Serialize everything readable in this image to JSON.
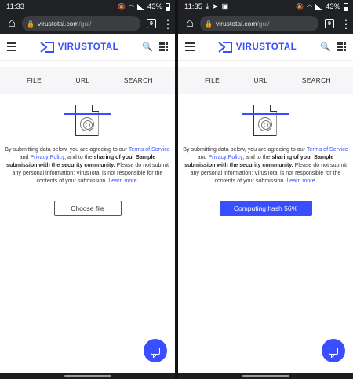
{
  "panels": [
    {
      "status": {
        "time": "11:33",
        "battery": "43%"
      },
      "url": {
        "domain": "virustotal.com",
        "path": "/gui/"
      },
      "tabs_count": "9",
      "logo": "VIRUSTOTAL",
      "nav_tabs": [
        "FILE",
        "URL",
        "SEARCH"
      ],
      "notice": {
        "part1": "By submitting data below, you are agreeing to our ",
        "tos": "Terms of Service",
        "part2": " and ",
        "privacy": "Privacy Policy",
        "part3": ", and to the ",
        "bold": "sharing of your Sample submission with the security community.",
        "part4": " Please do not submit any personal information; VirusTotal is not responsible for the contents of your submission. ",
        "learn": "Learn more."
      },
      "button_label": "Choose file"
    },
    {
      "status": {
        "time": "11:35",
        "battery": "43%"
      },
      "url": {
        "domain": "virustotal.com",
        "path": "/gui/"
      },
      "tabs_count": "9",
      "logo": "VIRUSTOTAL",
      "nav_tabs": [
        "FILE",
        "URL",
        "SEARCH"
      ],
      "notice": {
        "part1": "By submitting data below, you are agreeing to our ",
        "tos": "Terms of Service",
        "part2": " and ",
        "privacy": "Privacy Policy",
        "part3": ", and to the ",
        "bold": "sharing of your Sample submission with the security community.",
        "part4": " Please do not submit any personal information; VirusTotal is not responsible for the contents of your submission. ",
        "learn": "Learn more."
      },
      "button_label": "Computing hash 56%",
      "hash_progress": 0.56
    }
  ],
  "colors": {
    "accent": "#394eff",
    "chrome_bar": "#202124",
    "url_pill": "#3c3d40"
  },
  "icons": [
    "home-icon",
    "lock-icon",
    "tabs-icon",
    "menu-icon",
    "hamburger-icon",
    "virustotal-logo-icon",
    "search-icon",
    "apps-grid-icon",
    "upload-file-icon",
    "chat-icon",
    "mute-icon",
    "wifi-icon",
    "signal-icon",
    "battery-icon",
    "download-icon",
    "telegram-icon",
    "image-icon"
  ]
}
